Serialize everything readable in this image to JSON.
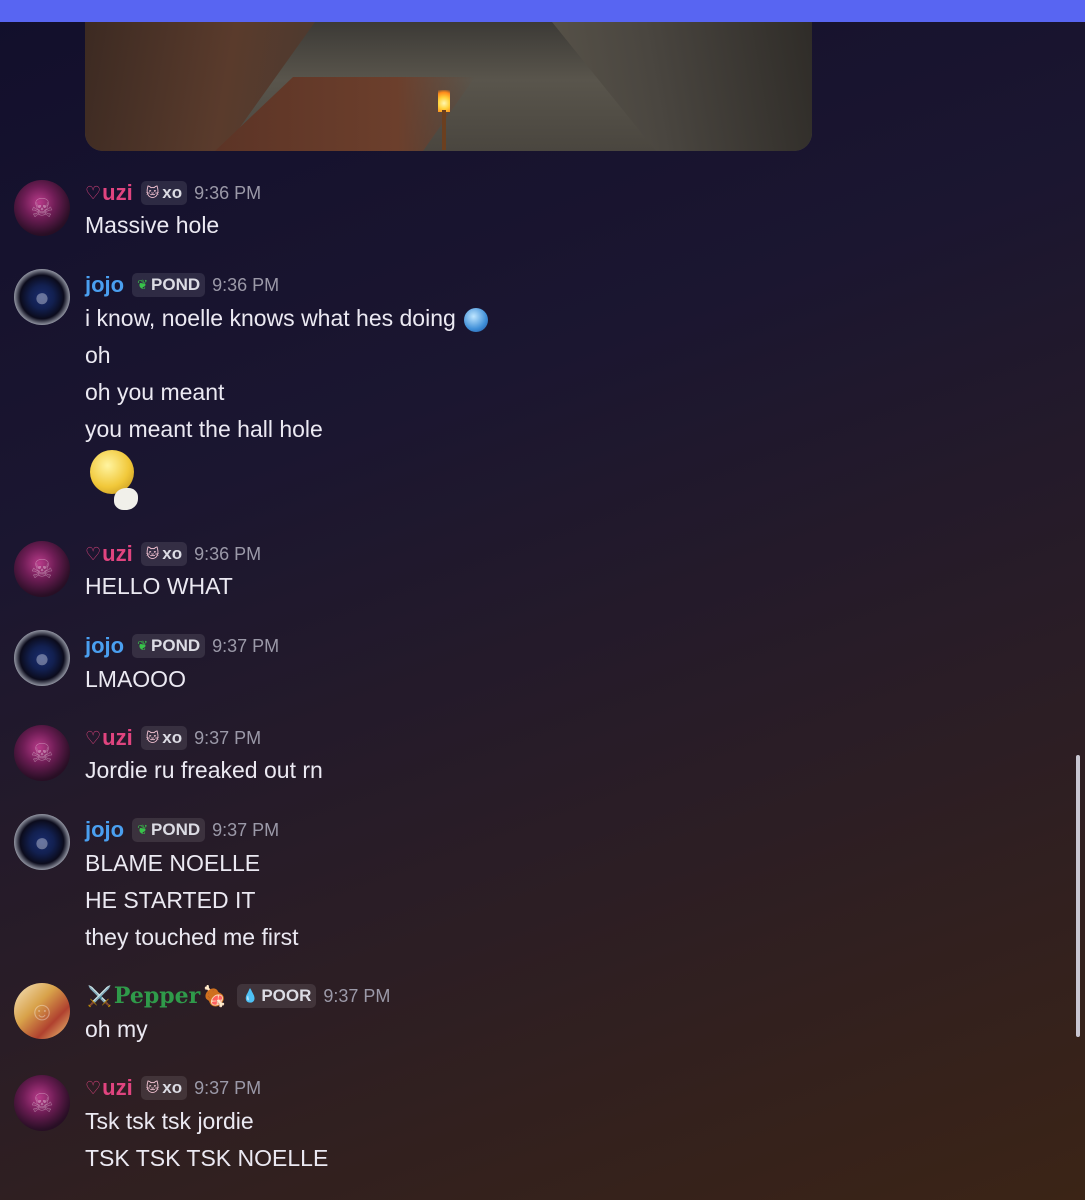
{
  "attachment": {
    "description_icon": "torch-icon"
  },
  "messages": [
    {
      "user": "uzi",
      "prefix": "♡",
      "tag": "xo",
      "tag_icon": "cat-icon",
      "time": "9:36 PM",
      "lines": [
        "Massive hole"
      ]
    },
    {
      "user": "jojo",
      "tag": "POND",
      "tag_icon": "leaf-icon",
      "time": "9:36 PM",
      "lines": [
        "i know, noelle knows what hes doing",
        "oh",
        "oh you meant",
        "you meant the hall hole"
      ]
    },
    {
      "user": "uzi",
      "prefix": "♡",
      "tag": "xo",
      "tag_icon": "cat-icon",
      "time": "9:36 PM",
      "lines": [
        "HELLO WHAT"
      ]
    },
    {
      "user": "jojo",
      "tag": "POND",
      "tag_icon": "leaf-icon",
      "time": "9:37 PM",
      "lines": [
        "LMAOOO"
      ]
    },
    {
      "user": "uzi",
      "prefix": "♡",
      "tag": "xo",
      "tag_icon": "cat-icon",
      "time": "9:37 PM",
      "lines": [
        "Jordie ru freaked out rn"
      ]
    },
    {
      "user": "jojo",
      "tag": "POND",
      "tag_icon": "leaf-icon",
      "time": "9:37 PM",
      "lines": [
        "BLAME NOELLE",
        "HE STARTED IT",
        "they touched me first"
      ]
    },
    {
      "user": "Pepper",
      "prefix": "⚔️",
      "suffix": "🍖",
      "tag": "POOR",
      "tag_icon": "droplet-icon",
      "time": "9:37 PM",
      "lines": [
        "oh my"
      ]
    },
    {
      "user": "uzi",
      "prefix": "♡",
      "tag": "xo",
      "tag_icon": "cat-icon",
      "time": "9:37 PM",
      "lines": [
        "Tsk tsk tsk jordie",
        "TSK TSK TSK NOELLE"
      ]
    }
  ],
  "colors": {
    "uzi": "#e0447f",
    "jojo": "#4a9ff0",
    "pepper": "#2f9a4a",
    "accent_bar": "#5865f2"
  }
}
